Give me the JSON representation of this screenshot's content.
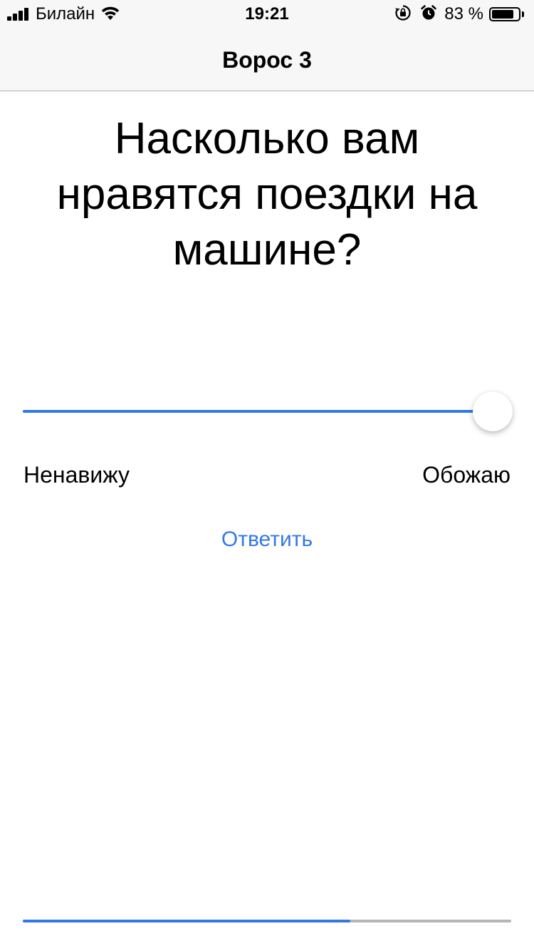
{
  "status_bar": {
    "carrier": "Билайн",
    "time": "19:21",
    "battery_text": "83 %",
    "battery_level": 0.83,
    "signal_bars": 4,
    "icons": [
      "signal-icon",
      "wifi-icon",
      "orientation-lock-icon",
      "alarm-icon",
      "battery-icon"
    ]
  },
  "nav": {
    "title": "Ворос 3"
  },
  "question": {
    "text": "Насколько вам нравятся поездки на машине?"
  },
  "slider": {
    "value": 1.0,
    "min_label": "Ненавижу",
    "max_label": "Обожаю"
  },
  "actions": {
    "answer_label": "Ответить"
  },
  "progress": {
    "value": 0.67
  },
  "colors": {
    "accent": "#3478e8",
    "track": "#b6b6b6",
    "bar_background": "#f7f7f7",
    "text": "#000000"
  }
}
